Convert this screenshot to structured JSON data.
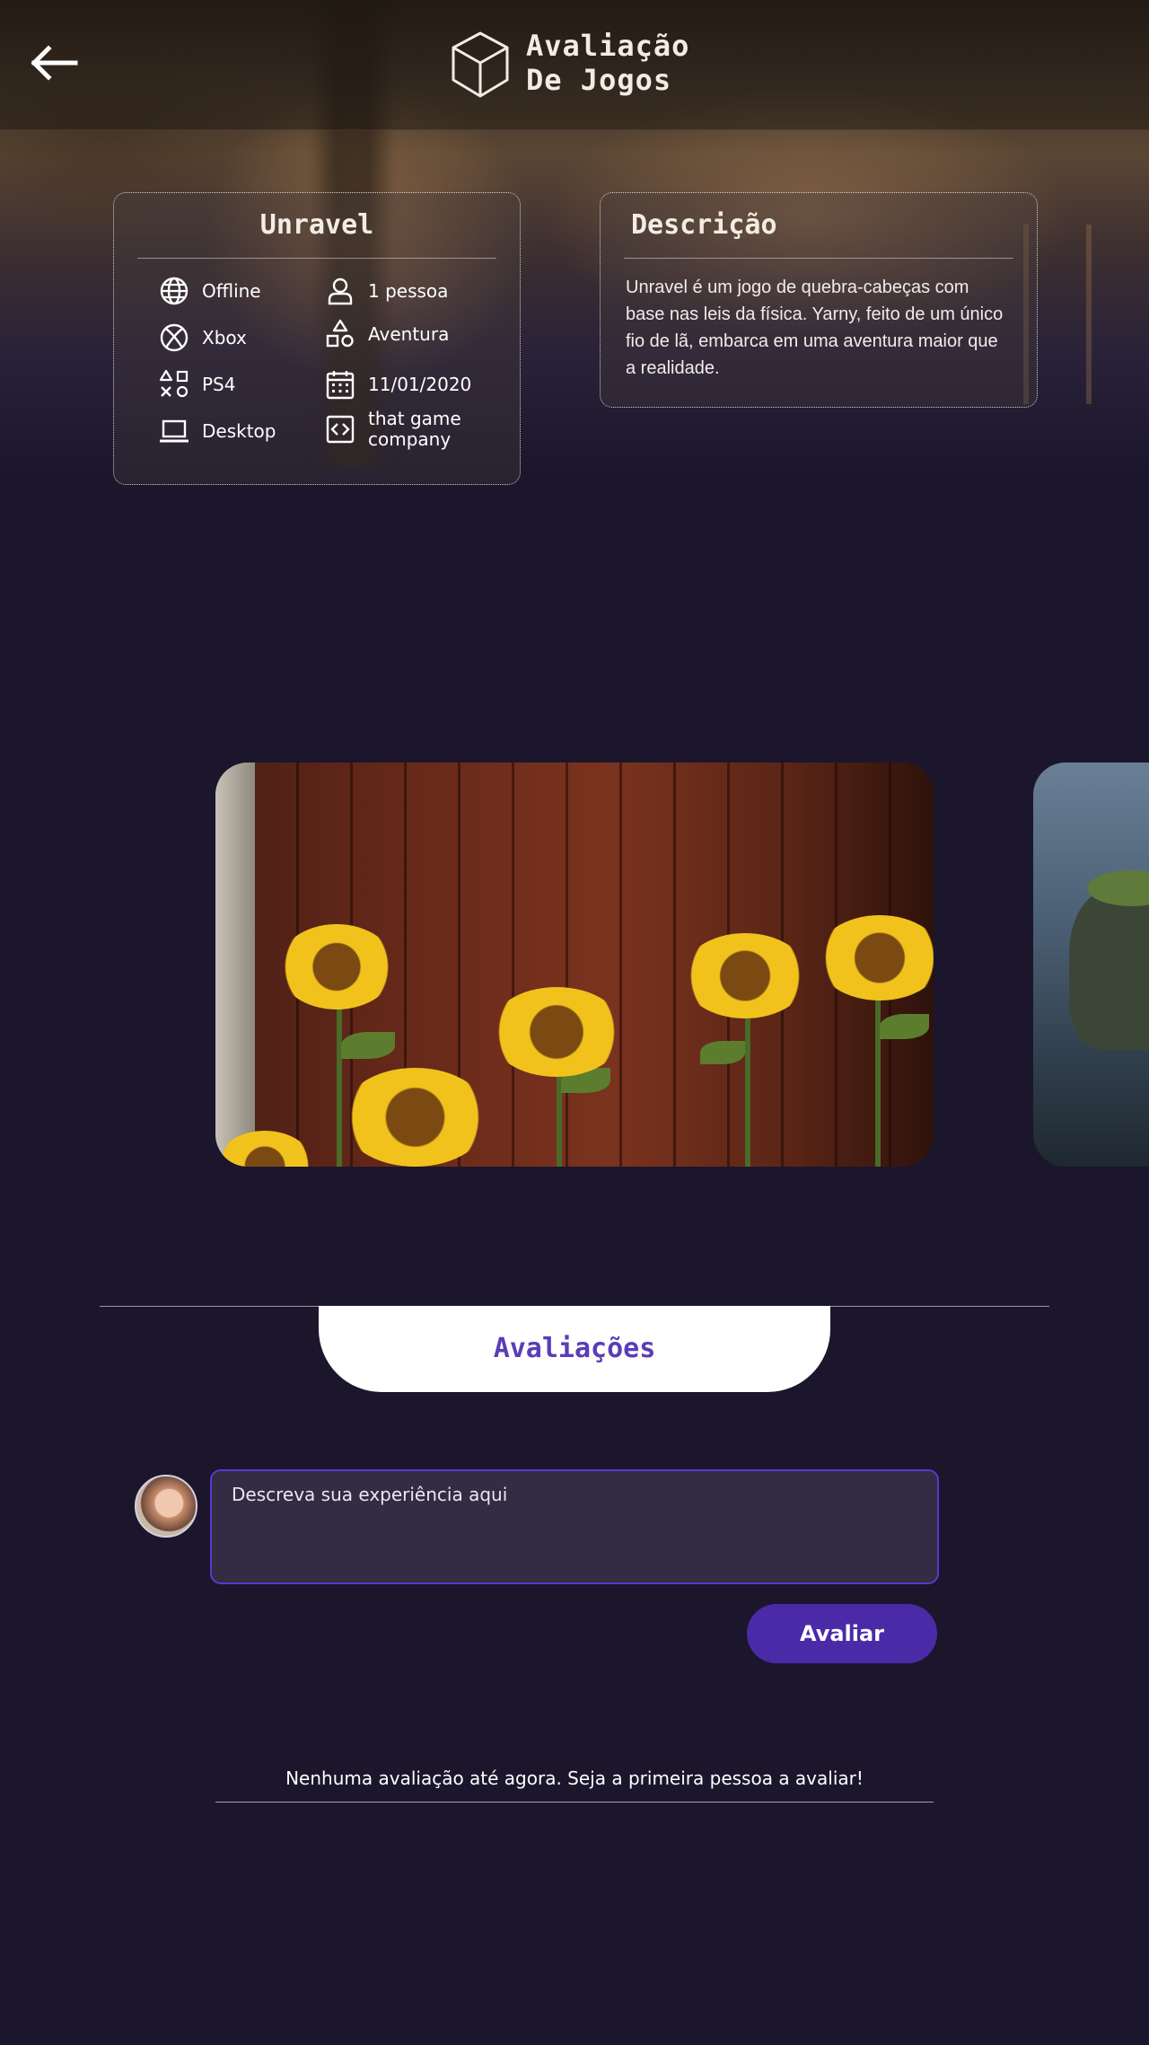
{
  "header": {
    "title_line1": "Avaliação",
    "title_line2": "De Jogos",
    "back_icon": "arrow-left-icon",
    "logo_icon": "cube-icon"
  },
  "game": {
    "name": "Unravel",
    "info": [
      {
        "icon": "globe-icon",
        "label": "Offline"
      },
      {
        "icon": "person-icon",
        "label": "1 pessoa"
      },
      {
        "icon": "xbox-icon",
        "label": "Xbox"
      },
      {
        "icon": "shapes-icon",
        "label": "Aventura"
      },
      {
        "icon": "playstation-icon",
        "label": "PS4"
      },
      {
        "icon": "calendar-icon",
        "label": "11/01/2020"
      },
      {
        "icon": "laptop-icon",
        "label": "Desktop"
      },
      {
        "icon": "code-icon",
        "label": "that game company"
      }
    ]
  },
  "description": {
    "title": "Descrição",
    "text": "Unravel é um jogo de quebra-cabeças com base nas leis da física. Yarny, feito de um único fio de lã, embarca em uma aventura maior que a realidade."
  },
  "reviews": {
    "title": "Avaliações",
    "input_placeholder": "Descreva sua experiência aqui",
    "submit_label": "Avaliar",
    "empty_message": "Nenhuma avaliação até agora. Seja a primeira pessoa a avaliar!"
  },
  "colors": {
    "background": "#1b162c",
    "accent": "#4b2aa8",
    "accent_border": "#5a37d0",
    "reviews_title": "#5b3cb8"
  }
}
